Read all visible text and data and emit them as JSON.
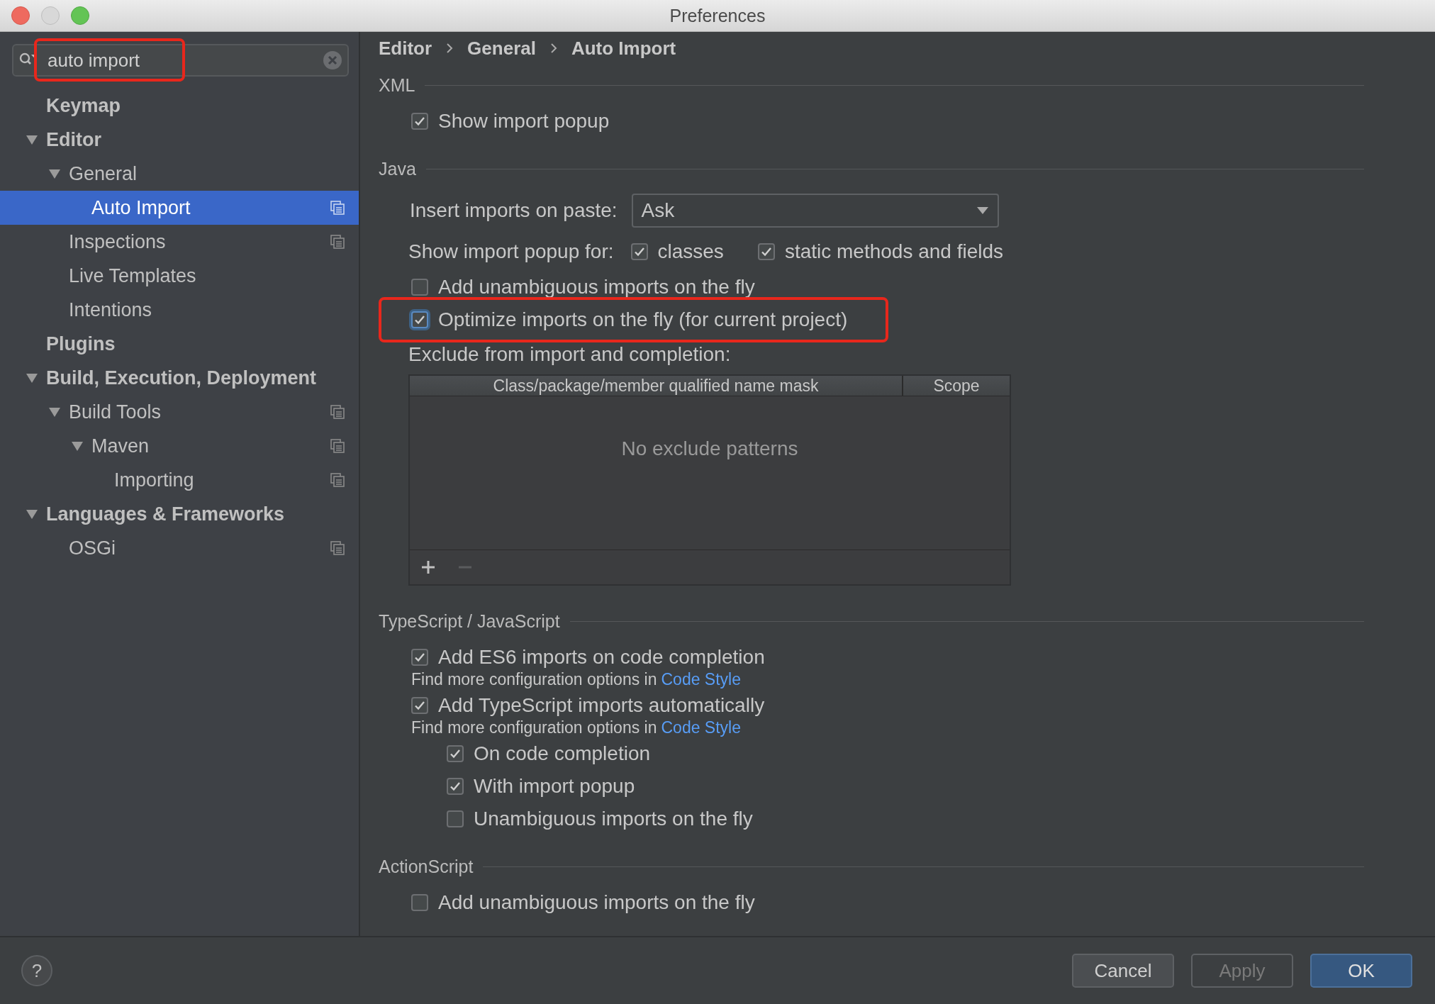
{
  "window": {
    "title": "Preferences"
  },
  "search": {
    "value": "auto import",
    "highlighted": true
  },
  "sidebar": {
    "items": [
      {
        "label": "Keymap",
        "selected": false,
        "project_icon": false
      },
      {
        "label": "Editor",
        "expanded": true,
        "selected": false,
        "project_icon": false,
        "children": [
          {
            "label": "General",
            "expanded": true,
            "selected": false,
            "project_icon": false,
            "children": [
              {
                "label": "Auto Import",
                "selected": true,
                "project_icon": true
              }
            ]
          },
          {
            "label": "Inspections",
            "selected": false,
            "project_icon": true
          },
          {
            "label": "Live Templates",
            "selected": false,
            "project_icon": false
          },
          {
            "label": "Intentions",
            "selected": false,
            "project_icon": false
          }
        ]
      },
      {
        "label": "Plugins",
        "selected": false,
        "project_icon": false
      },
      {
        "label": "Build, Execution, Deployment",
        "expanded": true,
        "selected": false,
        "project_icon": false,
        "children": [
          {
            "label": "Build Tools",
            "expanded": true,
            "selected": false,
            "project_icon": true,
            "children": [
              {
                "label": "Maven",
                "expanded": true,
                "selected": false,
                "project_icon": true,
                "children": [
                  {
                    "label": "Importing",
                    "selected": false,
                    "project_icon": true
                  }
                ]
              }
            ]
          }
        ]
      },
      {
        "label": "Languages & Frameworks",
        "expanded": true,
        "selected": false,
        "project_icon": false,
        "children": [
          {
            "label": "OSGi",
            "selected": false,
            "project_icon": true
          }
        ]
      }
    ]
  },
  "breadcrumb": [
    "Editor",
    "General",
    "Auto Import"
  ],
  "sections": [
    {
      "title": "XML",
      "rows": [
        {
          "kind": "checkbox",
          "label": "Show import popup",
          "checked": true,
          "focused": false,
          "highlighted": false
        }
      ]
    },
    {
      "title": "Java",
      "rows": [
        {
          "kind": "dropdown",
          "label": "Insert imports on paste:",
          "value": "Ask"
        },
        {
          "kind": "checkgroup",
          "label": "Show import popup for:",
          "options": [
            {
              "label": "classes",
              "checked": true
            },
            {
              "label": "static methods and fields",
              "checked": true
            }
          ]
        },
        {
          "kind": "checkbox",
          "label": "Add unambiguous imports on the fly",
          "checked": false,
          "focused": false,
          "highlighted": false
        },
        {
          "kind": "checkbox",
          "label": "Optimize imports on the fly (for current project)",
          "checked": true,
          "focused": true,
          "highlighted": true
        },
        {
          "kind": "table",
          "label": "Exclude from import and completion:",
          "columns": [
            "Class/package/member qualified name mask",
            "Scope"
          ],
          "empty_text": "No exclude patterns"
        }
      ]
    },
    {
      "title": "TypeScript / JavaScript",
      "rows": [
        {
          "kind": "checkbox",
          "label": "Add ES6 imports on code completion",
          "checked": true,
          "focused": false,
          "highlighted": false,
          "note": {
            "text": "Find more configuration options in",
            "link": "Code Style"
          }
        },
        {
          "kind": "checkbox",
          "label": "Add TypeScript imports automatically",
          "checked": true,
          "focused": false,
          "highlighted": false,
          "note": {
            "text": "Find more configuration options in",
            "link": "Code Style"
          },
          "children": [
            {
              "kind": "checkbox",
              "label": "On code completion",
              "checked": true,
              "focused": false,
              "highlighted": false
            },
            {
              "kind": "checkbox",
              "label": "With import popup",
              "checked": true,
              "focused": false,
              "highlighted": false
            },
            {
              "kind": "checkbox",
              "label": "Unambiguous imports on the fly",
              "checked": false,
              "focused": false,
              "highlighted": false
            }
          ]
        }
      ]
    },
    {
      "title": "ActionScript",
      "rows": [
        {
          "kind": "checkbox",
          "label": "Add unambiguous imports on the fly",
          "checked": false,
          "focused": false,
          "highlighted": false
        }
      ]
    }
  ],
  "buttons": [
    {
      "label": "Cancel",
      "kind": "normal"
    },
    {
      "label": "Apply",
      "kind": "disabled"
    },
    {
      "label": "OK",
      "kind": "default"
    }
  ],
  "help": "?"
}
